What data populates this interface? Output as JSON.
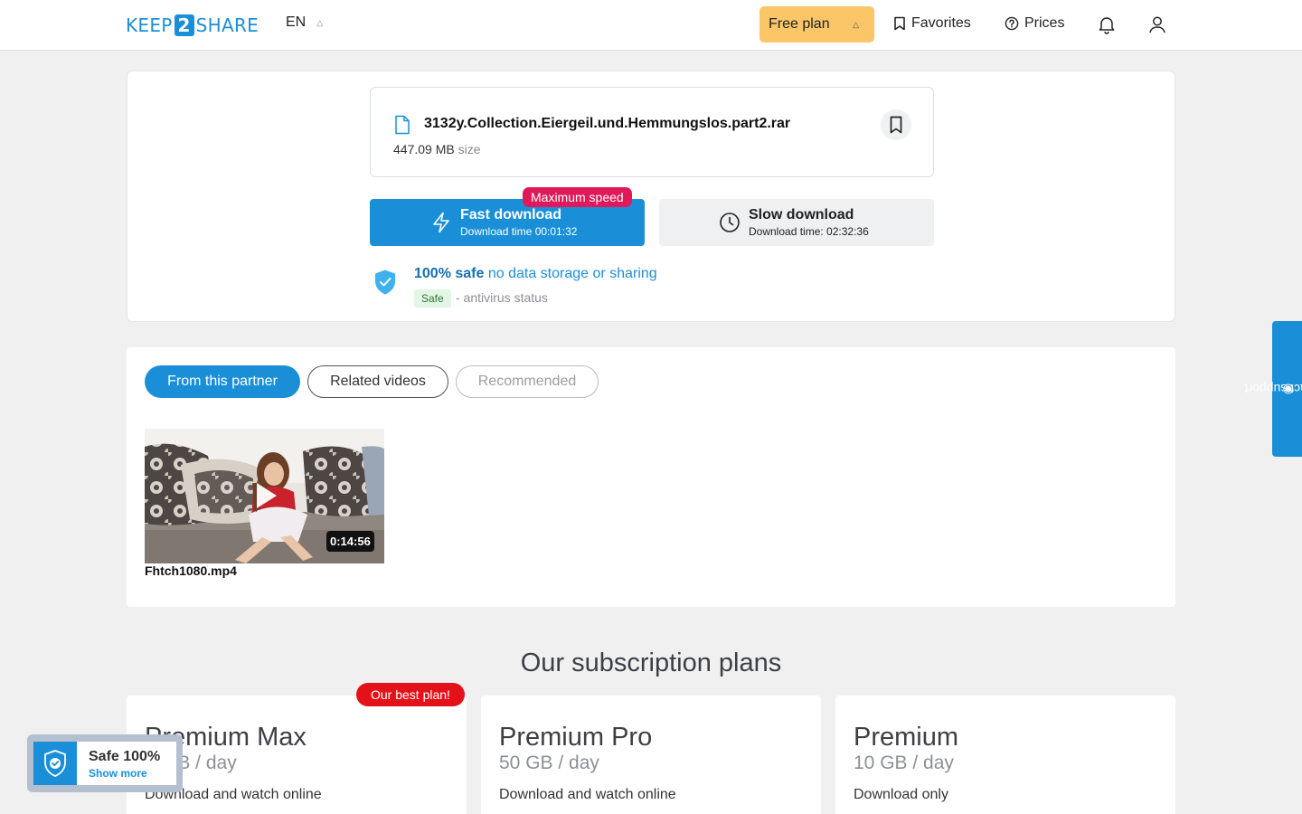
{
  "header": {
    "logo_left": "KEEP",
    "logo_num": "2",
    "logo_right": "SHARE",
    "language": "EN",
    "plan_label": "Free plan",
    "favorites_label": "Favorites",
    "prices_label": "Prices"
  },
  "file": {
    "name": "3132y.Collection.Eiergeil.und.Hemmungslos.part2.rar",
    "size_value": "447.09 MB",
    "size_unit": "size"
  },
  "download": {
    "fast_title": "Fast download",
    "fast_sub": "Download time 00:01:32",
    "max_badge": "Maximum speed",
    "slow_title": "Slow download",
    "slow_sub": "Download time: 02:32:36"
  },
  "safety": {
    "bold": "100% safe",
    "rest": "no data storage or sharing",
    "badge": "Safe",
    "status": "- antivirus status"
  },
  "tabs": {
    "partner": "From this partner",
    "related": "Related videos",
    "recommended": "Recommended"
  },
  "video": {
    "duration": "0:14:56",
    "name": "Fhtch1080.mp4"
  },
  "contact": "contact support",
  "plans": {
    "title": "Our subscription plans",
    "best_badge": "Our best plan!",
    "items": [
      {
        "name": "Premium Max",
        "quota": "GB / day",
        "desc": "Download and watch online"
      },
      {
        "name": "Premium Pro",
        "quota": "50 GB / day",
        "desc": "Download and watch online"
      },
      {
        "name": "Premium",
        "quota": "10 GB / day",
        "desc": "Download only"
      }
    ]
  },
  "widget": {
    "title": "Safe 100%",
    "sub": "Show more"
  },
  "colors": {
    "accent": "#1a8fd8",
    "plan_button": "#fbc667",
    "max_badge": "#e0195a",
    "best_badge": "#e31219"
  }
}
